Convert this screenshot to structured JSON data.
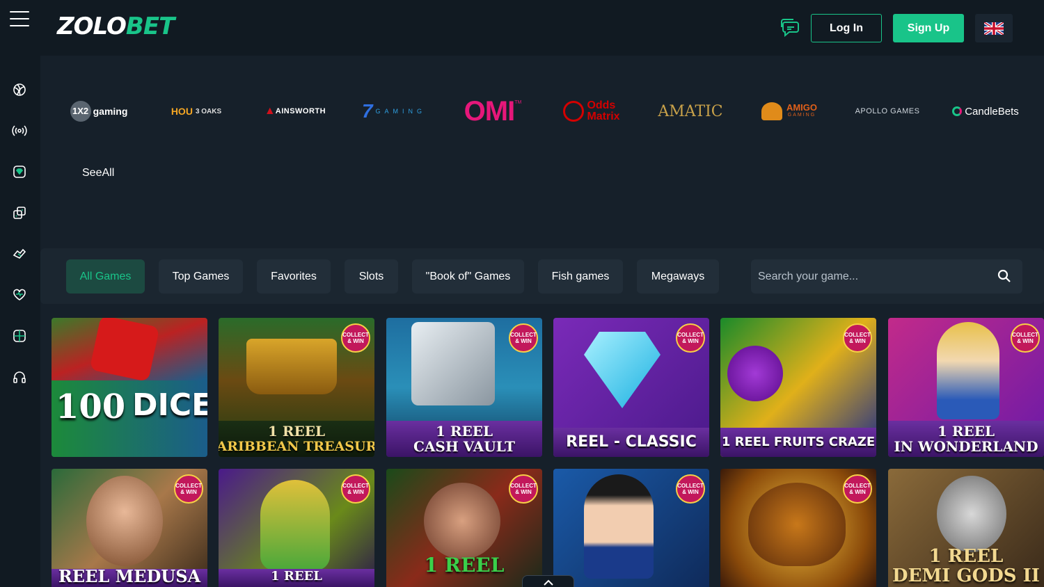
{
  "header": {
    "logo": {
      "prefix": "ZOLO",
      "suffix": "BET"
    },
    "login_label": "Log In",
    "signup_label": "Sign Up"
  },
  "colors": {
    "accent": "#19c489",
    "background": "#16202a",
    "panel": "#111a22"
  },
  "sidebar": {
    "items": [
      {
        "icon": "basketball-icon"
      },
      {
        "icon": "live-broadcast-icon"
      },
      {
        "icon": "casino-gem-icon"
      },
      {
        "icon": "dice-icon"
      },
      {
        "icon": "handshake-icon"
      },
      {
        "icon": "heart-icon"
      },
      {
        "icon": "gift-box-icon"
      },
      {
        "icon": "headphones-icon"
      }
    ]
  },
  "providers": {
    "items": [
      {
        "a": "1X2",
        "b": "gaming"
      },
      {
        "a": "HOU",
        "b": "3 OAKS"
      },
      {
        "a": "AINSWORTH",
        "b": ""
      },
      {
        "a": "7",
        "b": "GAMING"
      },
      {
        "a": "OMI",
        "b": "TM"
      },
      {
        "a": "Odds",
        "b": "Matrix"
      },
      {
        "a": "AMATIC",
        "b": ""
      },
      {
        "a": "AMIGO",
        "b": "GAMING"
      },
      {
        "a": "APOLLO GAMES",
        "b": ""
      },
      {
        "a": "CandleBets",
        "b": ""
      }
    ],
    "see_all": "SeeAll"
  },
  "filters": {
    "tabs": [
      "All Games",
      "Top Games",
      "Favorites",
      "Slots",
      "\"Book of\" Games",
      "Fish games",
      "Megaways"
    ],
    "active_tab": "All Games",
    "search_placeholder": "Search your game..."
  },
  "games": [
    {
      "l1": "100",
      "l2": "DICE",
      "badge": ""
    },
    {
      "l1": "1 REEL",
      "l2": "CARIBBEAN TREASURE",
      "badge": "COLLECT & WIN"
    },
    {
      "l1": "1 REEL",
      "l2": "CASH VAULT",
      "badge": "COLLECT & WIN"
    },
    {
      "l1": "",
      "l2": "REEL - CLASSIC",
      "badge": "COLLECT & WIN"
    },
    {
      "l1": "",
      "l2": "1 REEL FRUITS CRAZE",
      "badge": "COLLECT & WIN"
    },
    {
      "l1": "1 REEL",
      "l2": "IN WONDERLAND",
      "badge": "COLLECT & WIN"
    },
    {
      "l1": "",
      "l2": "REEL MEDUSA",
      "badge": "COLLECT & WIN"
    },
    {
      "l1": "",
      "l2": "1 REEL",
      "badge": "COLLECT & WIN"
    },
    {
      "l1": "",
      "l2": "1 REEL",
      "badge": "COLLECT & WIN"
    },
    {
      "l1": "",
      "l2": "",
      "badge": "COLLECT & WIN"
    },
    {
      "l1": "",
      "l2": "",
      "badge": "COLLECT & WIN"
    },
    {
      "l1": "1 REEL",
      "l2": "DEMI GODS II",
      "badge": ""
    }
  ]
}
